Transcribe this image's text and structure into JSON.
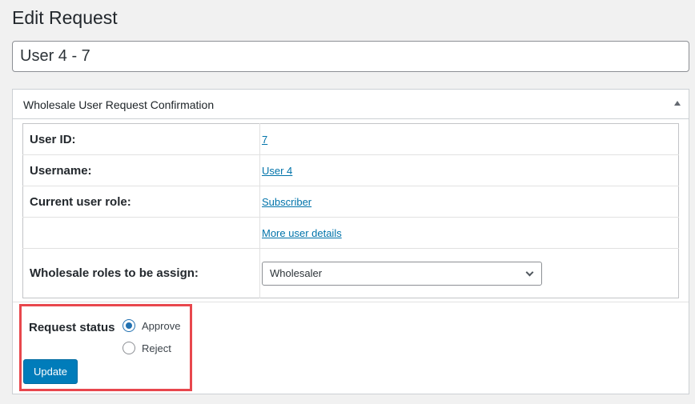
{
  "page": {
    "title": "Edit Request"
  },
  "title_field": {
    "value": "User 4 - 7"
  },
  "metabox": {
    "title": "Wholesale User Request Confirmation",
    "toggle_icon": "arrow-up-icon",
    "rows": [
      {
        "label": "User ID:",
        "value": "7"
      },
      {
        "label": "Username:",
        "value": "User 4"
      },
      {
        "label": "Current user role:",
        "value": "Subscriber"
      },
      {
        "label": "",
        "value": "More user details"
      }
    ],
    "roles_label": "Wholesale roles to be assign:",
    "roles_selected": "Wholesaler"
  },
  "status": {
    "label": "Request status",
    "options": [
      {
        "label": "Approve",
        "checked": true
      },
      {
        "label": "Reject",
        "checked": false
      }
    ],
    "highlight_color": "#e8474d",
    "update_label": "Update"
  },
  "colors": {
    "link": "#0073aa",
    "primary_button": "#007cba"
  }
}
